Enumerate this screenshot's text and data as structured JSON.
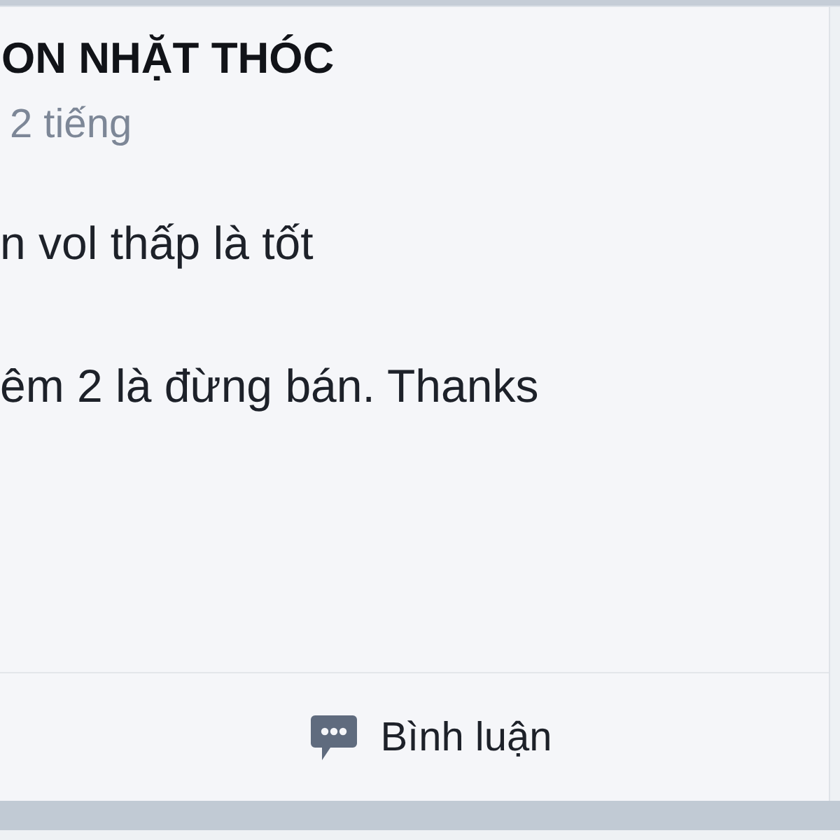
{
  "post": {
    "author": "ON NHẶT THÓC",
    "time": "2 tiếng",
    "body": [
      "n vol thấp là tốt",
      "êm 2 là đừng bán. Thanks"
    ],
    "actions": [
      {
        "kind": "comment",
        "label": "Bình luận"
      }
    ]
  }
}
